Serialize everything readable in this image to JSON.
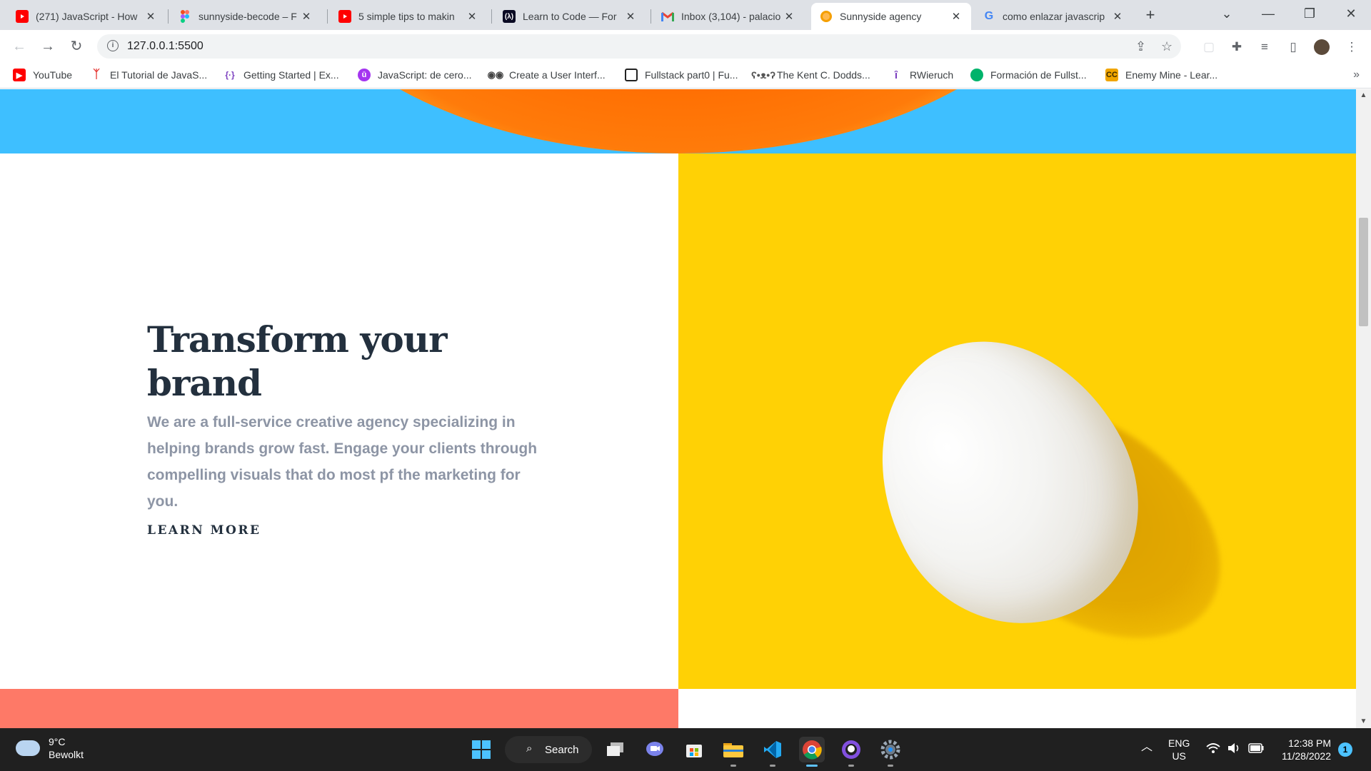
{
  "browser": {
    "tabs": [
      {
        "title": "(271) JavaScript - How",
        "favicon": "youtube-icon",
        "color": "#ff0000"
      },
      {
        "title": "sunnyside-becode – F",
        "favicon": "figma-icon",
        "color": "#f24e1e"
      },
      {
        "title": "5 simple tips to makin",
        "favicon": "youtube-icon",
        "color": "#ff0000"
      },
      {
        "title": "Learn to Code — For",
        "favicon": "freecodecamp-icon",
        "color": "#0a0a23"
      },
      {
        "title": "Inbox (3,104) - palacio",
        "favicon": "gmail-icon",
        "color": "#ea4335"
      },
      {
        "title": "Sunnyside agency",
        "favicon": "orange-icon",
        "color": "#f59f00",
        "active": true
      },
      {
        "title": "como enlazar javascrip",
        "favicon": "google-icon",
        "color": "#4285f4"
      }
    ],
    "new_tab": "+",
    "url": "127.0.0.1:5500",
    "bookmarks": [
      {
        "label": "YouTube",
        "icon": "youtube-icon",
        "color": "#ff0000"
      },
      {
        "label": "El Tutorial de JavaS...",
        "icon": "tutorial-icon",
        "color": "#e53935"
      },
      {
        "label": "Getting Started | Ex...",
        "icon": "express-icon",
        "color": "#7b3fbf"
      },
      {
        "label": "JavaScript: de cero...",
        "icon": "udemy-icon",
        "color": "#a435f0"
      },
      {
        "label": "Create a User Interf...",
        "icon": "glasses-icon",
        "color": "#444444"
      },
      {
        "label": "Fullstack part0 | Fu...",
        "icon": "fullstack-icon",
        "color": "#222222"
      },
      {
        "label": "The Kent C. Dodds...",
        "icon": "koala-icon",
        "color": "#555555"
      },
      {
        "label": "RWieruch",
        "icon": "rwieruch-icon",
        "color": "#7b3fbf"
      },
      {
        "label": "Formación de Fullst...",
        "icon": "formacion-icon",
        "color": "#00b36b"
      },
      {
        "label": "Enemy Mine - Lear...",
        "icon": "cc-icon",
        "color": "#f0a500"
      }
    ]
  },
  "page": {
    "headline_line1": "Transform your",
    "headline_line2": "brand",
    "body": "We are a full-service creative agency specializing in helping brands grow fast. Engage your clients through compelling visuals that do most pf the marketing for you.",
    "cta": "LEARN MORE",
    "colors": {
      "hero_blue": "#3ebfff",
      "yellow": "#ffd105",
      "salmon": "#fe7967",
      "headline": "#23303e",
      "body": "#8d95a5"
    }
  },
  "taskbar": {
    "temperature": "9°C",
    "condition": "Bewolkt",
    "search_label": "Search",
    "language": "ENG",
    "region": "US",
    "time": "12:38 PM",
    "date": "11/28/2022",
    "notification_count": "1"
  }
}
